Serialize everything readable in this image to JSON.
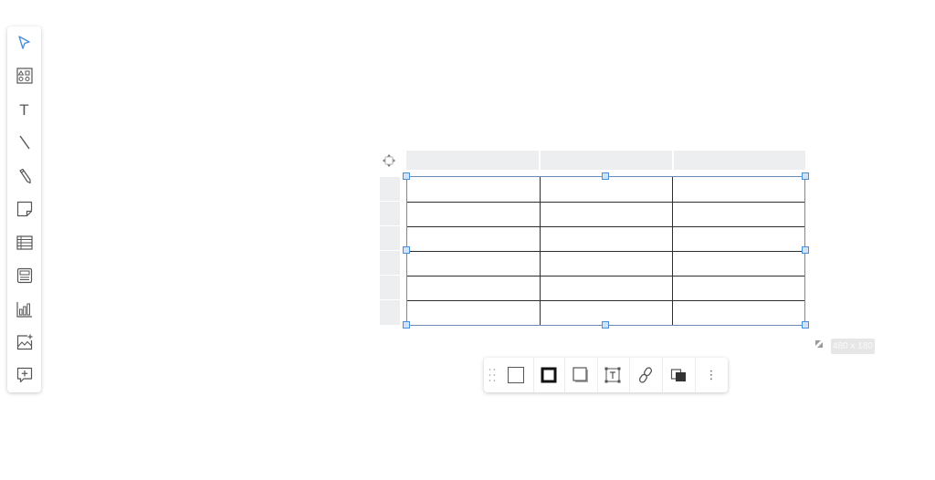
{
  "left_toolbar": {
    "tools": [
      {
        "icon": "select-arrow-icon",
        "label": ""
      },
      {
        "icon": "shapes-icon",
        "label": ""
      },
      {
        "icon": "text-tool-icon",
        "label": "T"
      },
      {
        "icon": "line-tool-icon",
        "label": ""
      },
      {
        "icon": "pen-tool-icon",
        "label": ""
      },
      {
        "icon": "sticky-note-icon",
        "label": ""
      },
      {
        "icon": "table-tool-icon",
        "label": ""
      },
      {
        "icon": "card-tool-icon",
        "label": ""
      },
      {
        "icon": "chart-tool-icon",
        "label": ""
      },
      {
        "icon": "image-tool-icon",
        "label": ""
      },
      {
        "icon": "comment-tool-icon",
        "label": ""
      }
    ],
    "active_tool": "select-arrow-icon"
  },
  "table": {
    "columns": 3,
    "rows": 6,
    "size_label": "480 x 180"
  },
  "context_toolbar": {
    "buttons": [
      {
        "icon": "fill-color-icon"
      },
      {
        "icon": "border-color-icon"
      },
      {
        "icon": "shadow-icon"
      },
      {
        "icon": "text-frame-icon"
      },
      {
        "icon": "link-icon"
      },
      {
        "icon": "arrange-layers-icon"
      },
      {
        "icon": "more-options-icon",
        "label": "⋮"
      }
    ]
  },
  "colors": {
    "accent": "#4a8fd9",
    "header_fill": "#edeef0",
    "grid_line": "#2e2e2e",
    "icon": "#555555"
  }
}
